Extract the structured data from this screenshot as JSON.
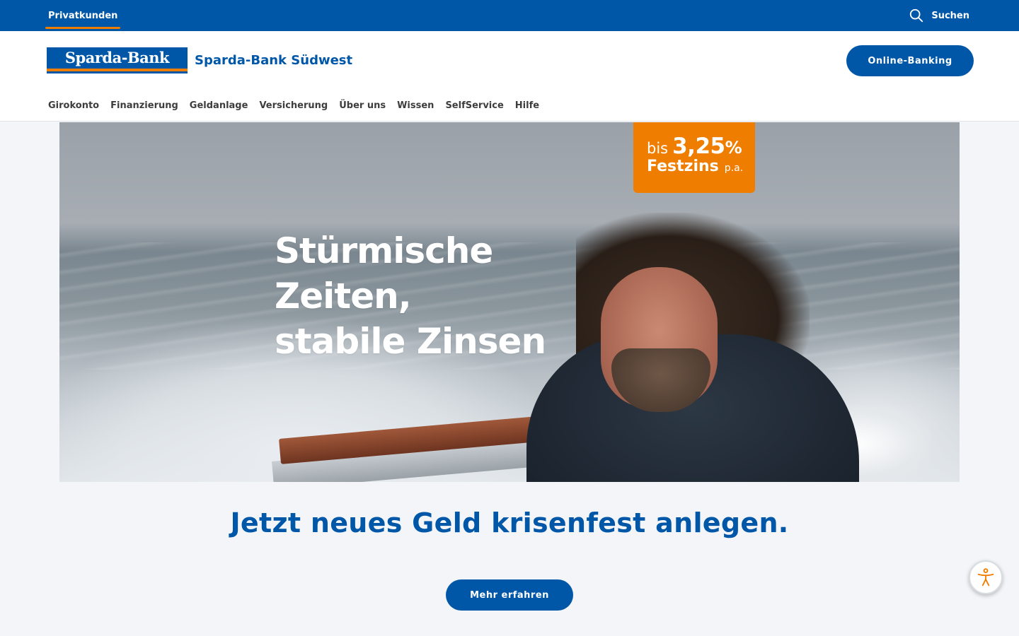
{
  "topbar": {
    "segment_label": "Privatkunden",
    "search_label": "Suchen",
    "search_icon": "search-icon"
  },
  "header": {
    "logo_text": "Sparda-Bank",
    "brand_name": "Sparda-Bank Südwest",
    "online_banking_label": "Online-Banking"
  },
  "nav": {
    "items": [
      {
        "label": "Girokonto"
      },
      {
        "label": "Finanzierung"
      },
      {
        "label": "Geldanlage"
      },
      {
        "label": "Versicherung"
      },
      {
        "label": "Über uns"
      },
      {
        "label": "Wissen"
      },
      {
        "label": "SelfService"
      },
      {
        "label": "Hilfe"
      }
    ]
  },
  "hero": {
    "headline_lines": [
      "Stürmische",
      "Zeiten,",
      "stabile Zinsen"
    ],
    "badge": {
      "prefix": "bis",
      "rate": "3,25",
      "percent": "%",
      "label": "Festzins",
      "suffix": "p.a."
    }
  },
  "cta": {
    "headline": "Jetzt neues Geld krisenfest anlegen.",
    "button_label": "Mehr erfahren"
  },
  "accessibility": {
    "icon": "accessibility-icon"
  },
  "colors": {
    "brand_blue": "#0057a8",
    "accent_orange": "#ef7d00",
    "page_background": "#f3f5f8"
  }
}
